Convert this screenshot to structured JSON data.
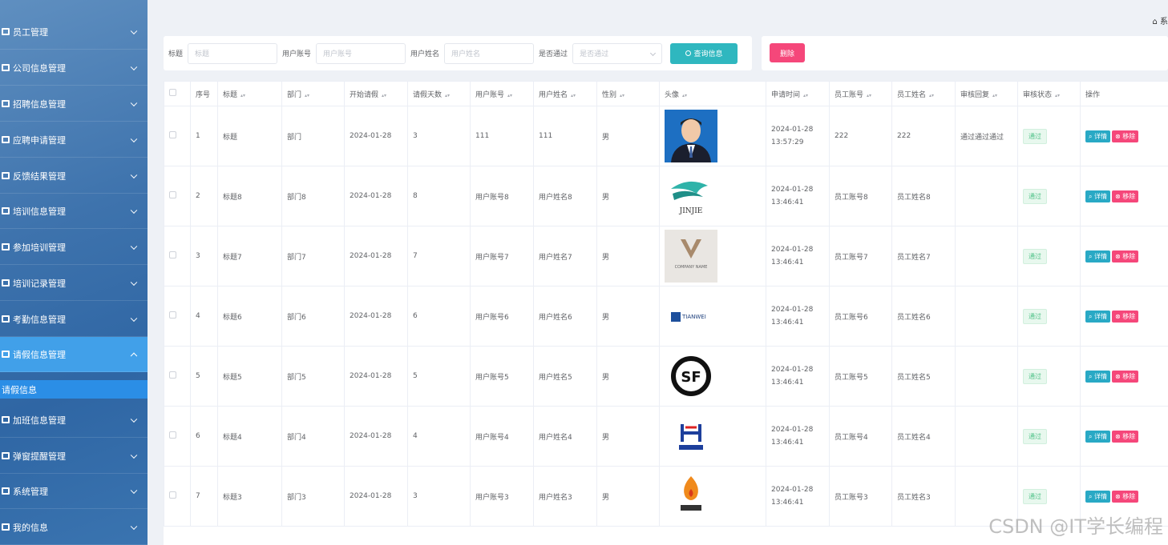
{
  "sidebar": {
    "items": [
      {
        "label": "员工管理",
        "icon": "user-icon"
      },
      {
        "label": "公司信息管理",
        "icon": "list-icon"
      },
      {
        "label": "招聘信息管理",
        "icon": "list-icon"
      },
      {
        "label": "应聘申请管理",
        "icon": "grid-icon"
      },
      {
        "label": "反馈结果管理",
        "icon": "briefcase-icon"
      },
      {
        "label": "培训信息管理",
        "icon": "grid-icon"
      },
      {
        "label": "参加培训管理",
        "icon": "grid-icon"
      },
      {
        "label": "培训记录管理",
        "icon": "chat-icon"
      },
      {
        "label": "考勤信息管理",
        "icon": "card-icon"
      },
      {
        "label": "请假信息管理",
        "icon": "grid-icon"
      },
      {
        "label": "加班信息管理",
        "icon": "list-icon"
      },
      {
        "label": "弹窗提醒管理",
        "icon": "chat-icon"
      },
      {
        "label": "系统管理",
        "icon": "flag-icon"
      },
      {
        "label": "我的信息",
        "icon": "list-icon"
      }
    ],
    "active_index": 9,
    "sub_item": "请假信息"
  },
  "breadcrumb": "系",
  "search": {
    "fields": [
      {
        "label": "标题",
        "placeholder": "标题"
      },
      {
        "label": "用户账号",
        "placeholder": "用户账号"
      },
      {
        "label": "用户姓名",
        "placeholder": "用户姓名"
      },
      {
        "label": "是否通过",
        "placeholder": "是否通过"
      }
    ],
    "button": "查询信息"
  },
  "actions": {
    "delete": "删除"
  },
  "table": {
    "columns": [
      "序号",
      "标题",
      "部门",
      "开始请假",
      "请假天数",
      "用户账号",
      "用户姓名",
      "性别",
      "头像",
      "申请时间",
      "员工账号",
      "员工姓名",
      "审核回复",
      "审核状态",
      "操作"
    ],
    "rows": [
      {
        "no": "1",
        "title": "标题",
        "dept": "部门",
        "start": "2024-01-28",
        "days": "3",
        "account": "111",
        "name": "111",
        "gender": "男",
        "avatar": "portrait",
        "apply_time": "2024-01-28 13:57:29",
        "emp_account": "222",
        "emp_name": "222",
        "reply": "通过通过通过",
        "status": "通过"
      },
      {
        "no": "2",
        "title": "标题8",
        "dept": "部门8",
        "start": "2024-01-28",
        "days": "8",
        "account": "用户账号8",
        "name": "用户姓名8",
        "gender": "男",
        "avatar": "jinjie-logo",
        "apply_time": "2024-01-28 13:46:41",
        "emp_account": "员工账号8",
        "emp_name": "员工姓名8",
        "reply": "",
        "status": "通过"
      },
      {
        "no": "3",
        "title": "标题7",
        "dept": "部门7",
        "start": "2024-01-28",
        "days": "7",
        "account": "用户账号7",
        "name": "用户姓名7",
        "gender": "男",
        "avatar": "company-logo",
        "apply_time": "2024-01-28 13:46:41",
        "emp_account": "员工账号7",
        "emp_name": "员工姓名7",
        "reply": "",
        "status": "通过"
      },
      {
        "no": "4",
        "title": "标题6",
        "dept": "部门6",
        "start": "2024-01-28",
        "days": "6",
        "account": "用户账号6",
        "name": "用户姓名6",
        "gender": "男",
        "avatar": "tianwei-logo",
        "apply_time": "2024-01-28 13:46:41",
        "emp_account": "员工账号6",
        "emp_name": "员工姓名6",
        "reply": "",
        "status": "通过"
      },
      {
        "no": "5",
        "title": "标题5",
        "dept": "部门5",
        "start": "2024-01-28",
        "days": "5",
        "account": "用户账号5",
        "name": "用户姓名5",
        "gender": "男",
        "avatar": "sf-logo",
        "apply_time": "2024-01-28 13:46:41",
        "emp_account": "员工账号5",
        "emp_name": "员工姓名5",
        "reply": "",
        "status": "通过"
      },
      {
        "no": "6",
        "title": "标题4",
        "dept": "部门4",
        "start": "2024-01-28",
        "days": "4",
        "account": "用户账号4",
        "name": "用户姓名4",
        "gender": "男",
        "avatar": "huaxia-logo",
        "apply_time": "2024-01-28 13:46:41",
        "emp_account": "员工账号4",
        "emp_name": "员工姓名4",
        "reply": "",
        "status": "通过"
      },
      {
        "no": "7",
        "title": "标题3",
        "dept": "部门3",
        "start": "2024-01-28",
        "days": "3",
        "account": "用户账号3",
        "name": "用户姓名3",
        "gender": "男",
        "avatar": "service-logo",
        "apply_time": "2024-01-28 13:46:41",
        "emp_account": "员工账号3",
        "emp_name": "员工姓名3",
        "reply": "",
        "status": "通过"
      }
    ],
    "op_detail": "详情",
    "op_remove": "移除"
  },
  "watermark": "CSDN @IT学长编程",
  "colors": {
    "sidebar": "#3e73ad",
    "active": "#41a0e9",
    "search_btn": "#2fb7bf",
    "delete_btn": "#f5477a",
    "pass_tag": "#52c28a"
  }
}
